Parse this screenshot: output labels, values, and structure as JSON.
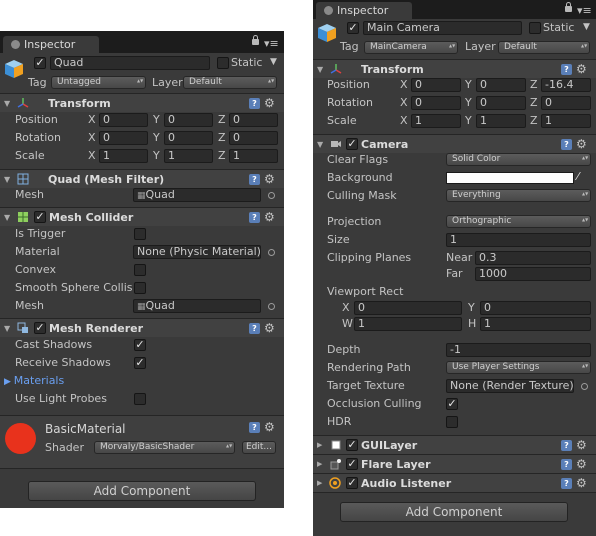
{
  "left": {
    "tab": "Inspector",
    "object": {
      "name": "Quad",
      "static_label": "Static",
      "tag_label": "Tag",
      "tag": "Untagged",
      "layer_label": "Layer",
      "layer": "Default"
    },
    "transform": {
      "title": "Transform",
      "rows": [
        {
          "label": "Position",
          "x": "0",
          "y": "0",
          "z": "0"
        },
        {
          "label": "Rotation",
          "x": "0",
          "y": "0",
          "z": "0"
        },
        {
          "label": "Scale",
          "x": "1",
          "y": "1",
          "z": "1"
        }
      ]
    },
    "mesh_filter": {
      "title": "Quad (Mesh Filter)",
      "mesh_label": "Mesh",
      "mesh": "Quad"
    },
    "mesh_collider": {
      "title": "Mesh Collider",
      "is_trigger_label": "Is Trigger",
      "material_label": "Material",
      "material": "None (Physic Material)",
      "convex_label": "Convex",
      "smooth_label": "Smooth Sphere Collisi",
      "mesh_label": "Mesh",
      "mesh": "Quad"
    },
    "mesh_renderer": {
      "title": "Mesh Renderer",
      "cast_shadows_label": "Cast Shadows",
      "receive_shadows_label": "Receive Shadows",
      "materials_label": "Materials",
      "light_probes_label": "Use Light Probes"
    },
    "material": {
      "name": "BasicMaterial",
      "shader_label": "Shader",
      "shader": "Morvaly/BasicShader",
      "edit": "Edit...",
      "color": "#e8321c"
    },
    "add_component": "Add Component"
  },
  "right": {
    "tab": "Inspector",
    "object": {
      "name": "Main Camera",
      "static_label": "Static",
      "tag_label": "Tag",
      "tag": "MainCamera",
      "layer_label": "Layer",
      "layer": "Default"
    },
    "transform": {
      "title": "Transform",
      "rows": [
        {
          "label": "Position",
          "x": "0",
          "y": "0",
          "z": "-16.4"
        },
        {
          "label": "Rotation",
          "x": "0",
          "y": "0",
          "z": "0"
        },
        {
          "label": "Scale",
          "x": "1",
          "y": "1",
          "z": "1"
        }
      ]
    },
    "camera": {
      "title": "Camera",
      "clear_flags_label": "Clear Flags",
      "clear_flags": "Solid Color",
      "background_label": "Background",
      "culling_mask_label": "Culling Mask",
      "culling_mask": "Everything",
      "projection_label": "Projection",
      "projection": "Orthographic",
      "size_label": "Size",
      "size": "1",
      "clipping_label": "Clipping Planes",
      "near_label": "Near",
      "near": "0.3",
      "far_label": "Far",
      "far": "1000",
      "viewport_label": "Viewport Rect",
      "vx": "0",
      "vy": "0",
      "vw": "1",
      "vh": "1",
      "depth_label": "Depth",
      "depth": "-1",
      "rendering_path_label": "Rendering Path",
      "rendering_path": "Use Player Settings",
      "target_texture_label": "Target Texture",
      "target_texture": "None (Render Texture)",
      "occlusion_label": "Occlusion Culling",
      "hdr_label": "HDR"
    },
    "gui_layer": "GUILayer",
    "flare_layer": "Flare Layer",
    "audio_listener": "Audio Listener",
    "add_component": "Add Component"
  },
  "axis": {
    "x": "X",
    "y": "Y",
    "z": "Z",
    "w": "W",
    "h": "H"
  }
}
